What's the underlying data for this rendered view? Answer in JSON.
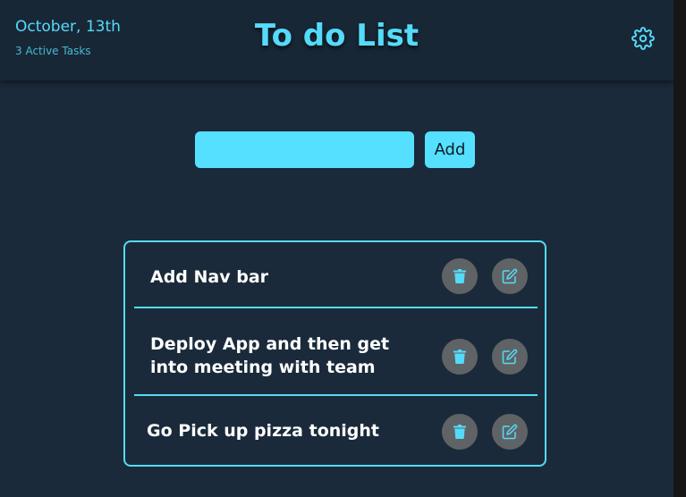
{
  "header": {
    "date": "October, 13th",
    "active_tasks": "3 Active Tasks",
    "title": "To do List",
    "settings_icon": "gear-icon"
  },
  "form": {
    "input_value": "",
    "add_label": "Add"
  },
  "tasks": [
    {
      "text": "Add Nav bar"
    },
    {
      "text": "Deploy App and then get into meeting with team"
    },
    {
      "text": "Go Pick up pizza tonight"
    }
  ],
  "icons": {
    "delete": "trash-icon",
    "edit": "edit-icon"
  },
  "colors": {
    "background": "#1a2a3a",
    "header": "#182736",
    "accent": "#55dbfa",
    "action_button": "#5f6365",
    "text": "#ffffff"
  }
}
